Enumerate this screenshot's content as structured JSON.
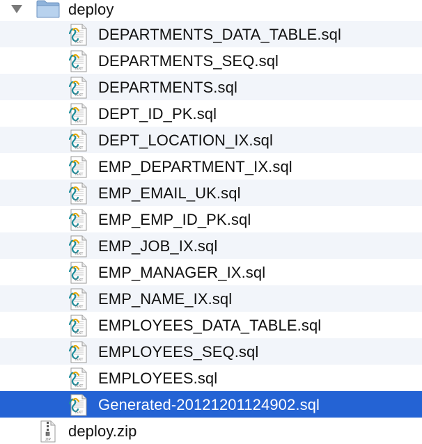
{
  "folder": {
    "name": "deploy",
    "expanded": true
  },
  "files": [
    {
      "name": "DEPARTMENTS_DATA_TABLE.sql",
      "icon": "sql-text-file-icon"
    },
    {
      "name": "DEPARTMENTS_SEQ.sql",
      "icon": "sql-text-file-icon"
    },
    {
      "name": "DEPARTMENTS.sql",
      "icon": "sql-text-file-icon"
    },
    {
      "name": "DEPT_ID_PK.sql",
      "icon": "sql-text-file-icon"
    },
    {
      "name": "DEPT_LOCATION_IX.sql",
      "icon": "sql-text-file-icon"
    },
    {
      "name": "EMP_DEPARTMENT_IX.sql",
      "icon": "sql-text-file-icon"
    },
    {
      "name": "EMP_EMAIL_UK.sql",
      "icon": "sql-text-file-icon"
    },
    {
      "name": "EMP_EMP_ID_PK.sql",
      "icon": "sql-text-file-icon"
    },
    {
      "name": "EMP_JOB_IX.sql",
      "icon": "sql-text-file-icon"
    },
    {
      "name": "EMP_MANAGER_IX.sql",
      "icon": "sql-text-file-icon"
    },
    {
      "name": "EMP_NAME_IX.sql",
      "icon": "sql-text-file-icon"
    },
    {
      "name": "EMPLOYEES_DATA_TABLE.sql",
      "icon": "sql-text-file-icon"
    },
    {
      "name": "EMPLOYEES_SEQ.sql",
      "icon": "sql-text-file-icon"
    },
    {
      "name": "EMPLOYEES.sql",
      "icon": "sql-text-file-icon"
    },
    {
      "name": "Generated-20121201124902.sql",
      "icon": "sql-text-file-icon",
      "selected": true
    }
  ],
  "zip": {
    "name": "deploy.zip",
    "icon": "zip-archive-icon",
    "icon_text": "ZIP"
  },
  "file_icon_text": "TEXT",
  "colors": {
    "selection": "#2463d4",
    "stripe": "#f2f5fa",
    "folder": "#a9c6e6"
  }
}
